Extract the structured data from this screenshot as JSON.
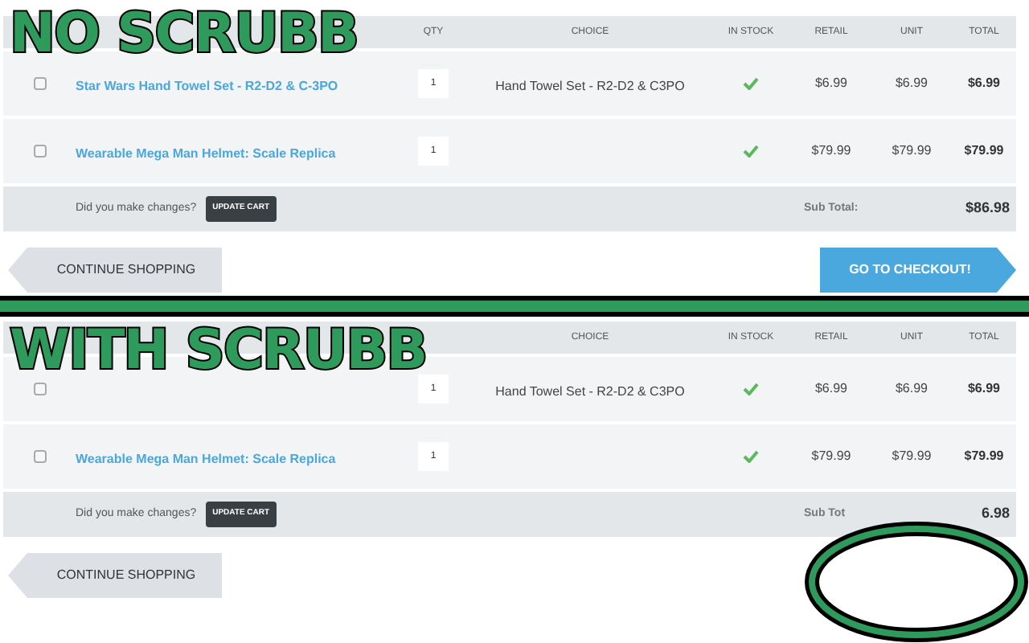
{
  "panels": [
    {
      "label": "NO SCRUBB",
      "header": {
        "qty": "QTY",
        "choice": "CHOICE",
        "in_stock": "IN STOCK",
        "retail": "RETAIL",
        "unit": "UNIT",
        "total": "TOTAL"
      },
      "rows": [
        {
          "checked": false,
          "name": "Star Wars Hand Towel Set - R2-D2 & C-3PO",
          "qty": "1",
          "choice": "Hand Towel Set - R2-D2 & C3PO",
          "in_stock": true,
          "retail": "$6.99",
          "unit": "$6.99",
          "total": "$6.99"
        },
        {
          "checked": false,
          "name": "Wearable Mega Man Helmet: Scale Replica",
          "qty": "1",
          "in_stock": true,
          "retail": "$79.99",
          "unit": "$79.99",
          "total": "$79.99"
        }
      ],
      "footer": {
        "prompt": "Did you make changes?",
        "update_button": "UPDATE CART",
        "sub_total_label": "Sub Total:",
        "sub_total": "$86.98"
      },
      "continue_button": "CONTINUE SHOPPING",
      "checkout_button": "GO TO CHECKOUT!",
      "circled": false
    },
    {
      "label": "WITH SCRUBB",
      "header": {
        "choice": "CHOICE",
        "in_stock": "IN STOCK",
        "retail": "RETAIL",
        "unit": "UNIT",
        "total": "TOTAL"
      },
      "rows": [
        {
          "checked": false,
          "qty": "1",
          "choice": "Hand Towel Set - R2-D2 & C3PO",
          "in_stock": true,
          "retail": "$6.99",
          "unit": "$6.99",
          "total": "$6.99"
        },
        {
          "checked": false,
          "name": "Wearable Mega Man Helmet: Scale Replica",
          "qty": "1",
          "in_stock": true,
          "retail": "$79.99",
          "unit": "$79.99",
          "total": "$79.99"
        }
      ],
      "footer": {
        "prompt": "Did you make changes?",
        "update_button": "UPDATE CART",
        "sub_total_label": "Sub Tot",
        "sub_total": "6.98"
      },
      "continue_button": "CONTINUE SHOPPING",
      "circled": true
    }
  ]
}
